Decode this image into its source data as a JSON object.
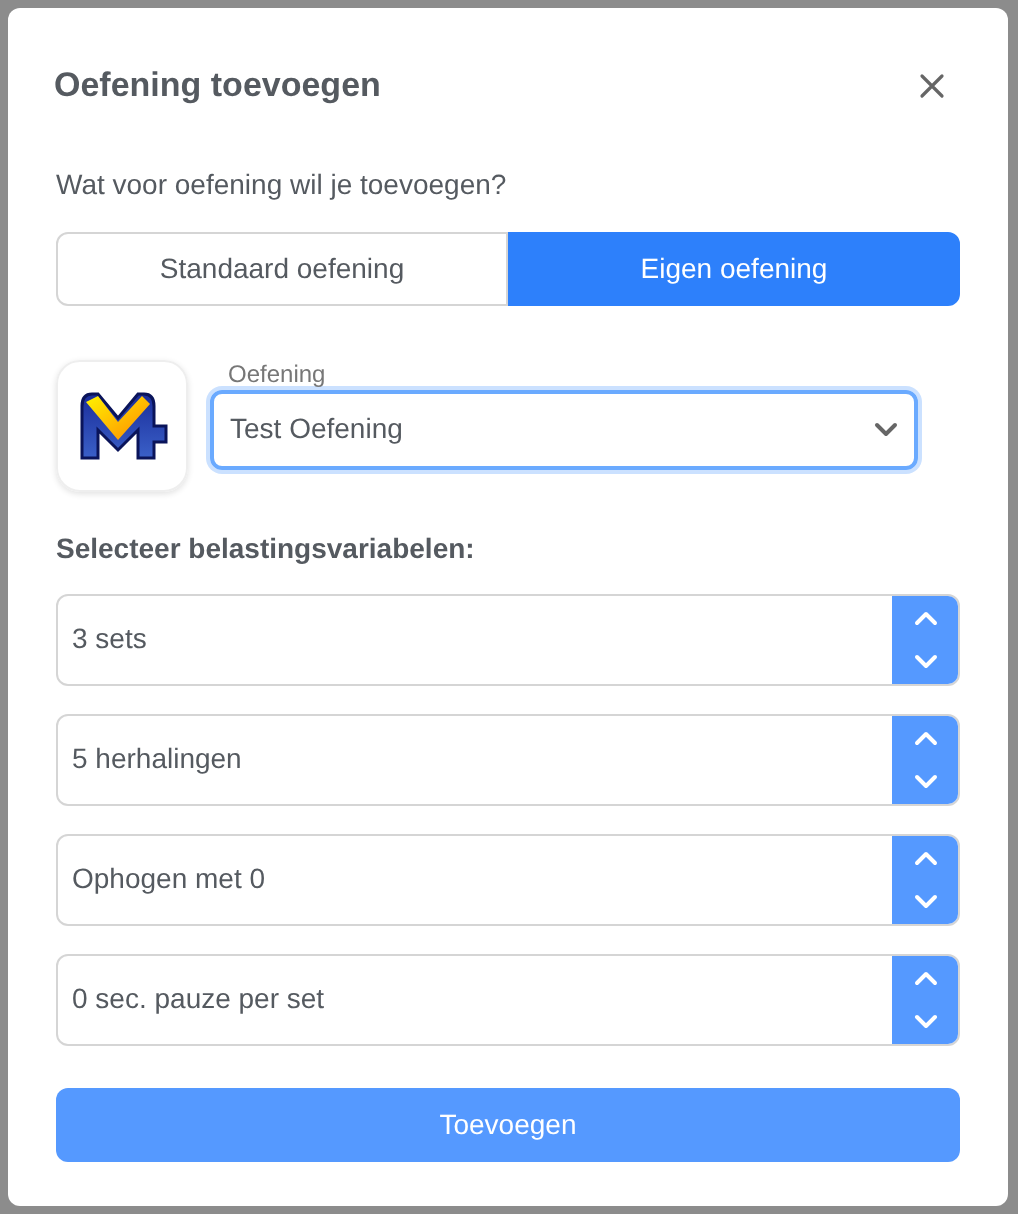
{
  "dialog": {
    "title": "Oefening toevoegen",
    "question": "Wat voor oefening wil je toevoegen?"
  },
  "tabs": [
    {
      "label": "Standaard oefening",
      "selected": false
    },
    {
      "label": "Eigen oefening",
      "selected": true
    }
  ],
  "exercise_select": {
    "label": "Oefening",
    "value": "Test Oefening"
  },
  "variables_heading": "Selecteer belastingsvariabelen:",
  "number_fields": [
    {
      "value": "3 sets"
    },
    {
      "value": "5 herhalingen"
    },
    {
      "value": "Ophogen met 0"
    },
    {
      "value": "0 sec. pauze per set"
    }
  ],
  "submit_button": "Toevoegen"
}
